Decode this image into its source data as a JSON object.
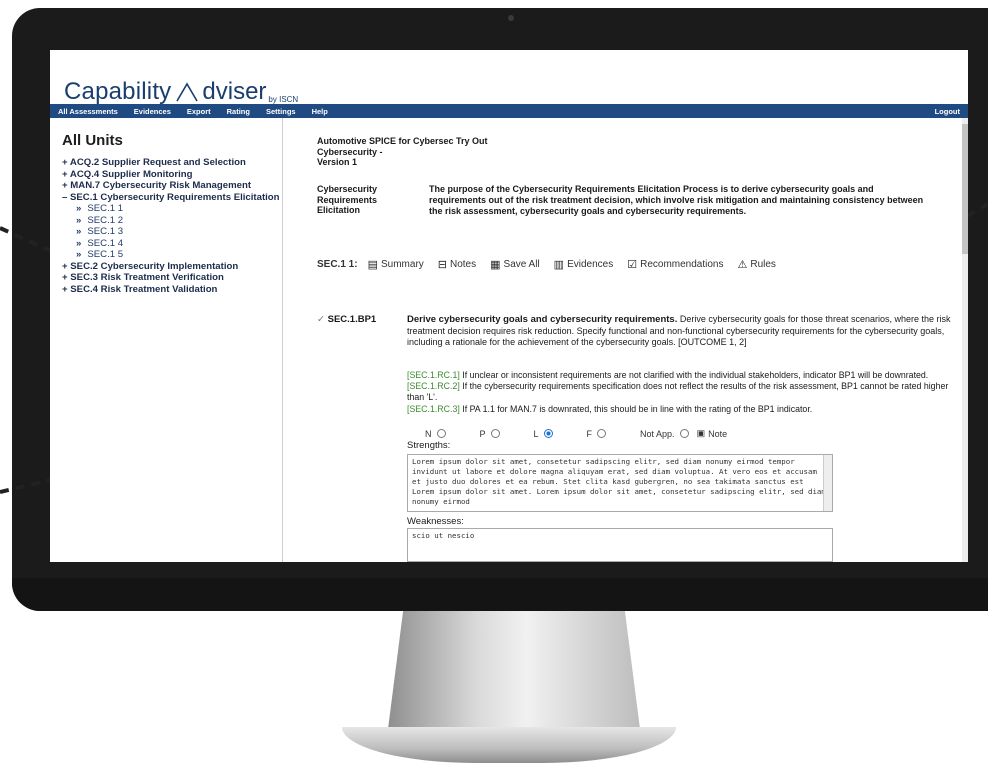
{
  "app": {
    "logo_word1": "Capability",
    "logo_word2": "dviser",
    "logo_by": "by ISCN"
  },
  "menu": {
    "items": [
      "All Assessments",
      "Evidences",
      "Export",
      "Rating",
      "Settings",
      "Help"
    ],
    "logout": "Logout"
  },
  "sidebar": {
    "title": "All Units",
    "tree": [
      {
        "label": "+ ACQ.2 Supplier Request and Selection",
        "level": 0
      },
      {
        "label": "+ ACQ.4 Supplier Monitoring",
        "level": 0
      },
      {
        "label": "+ MAN.7 Cybersecurity Risk Management",
        "level": 0
      },
      {
        "label": "– SEC.1 Cybersecurity Requirements Elicitation",
        "level": 0
      },
      {
        "label": "SEC.1 1",
        "level": 1
      },
      {
        "label": "SEC.1 2",
        "level": 1
      },
      {
        "label": "SEC.1 3",
        "level": 1
      },
      {
        "label": "SEC.1 4",
        "level": 1
      },
      {
        "label": "SEC.1 5",
        "level": 1
      },
      {
        "label": "+ SEC.2 Cybersecurity Implementation",
        "level": 0
      },
      {
        "label": "+ SEC.3 Risk Treatment Verification",
        "level": 0
      },
      {
        "label": "+ SEC.4 Risk Treatment Validation",
        "level": 0
      }
    ],
    "sub_marker": "»"
  },
  "header": {
    "line1": "Automotive SPICE for Cybersec Try Out",
    "line2": "Cybersecurity -",
    "line3": "Version 1"
  },
  "process": {
    "name": "Cybersecurity Requirements Elicitation",
    "purpose": "The purpose of the Cybersecurity Requirements Elicitation Process is to derive cybersecurity goals and requirements out of the risk treatment decision, which involve risk mitigation and maintaining consistency between the risk assessment, cybersecurity goals and cybersecurity requirements."
  },
  "toolbar": {
    "section_label": "SEC.1 1:",
    "buttons": [
      {
        "label": "Summary",
        "icon": "summary-icon",
        "glyph": "▤"
      },
      {
        "label": "Notes",
        "icon": "notes-icon",
        "glyph": "⊟"
      },
      {
        "label": "Save All",
        "icon": "save-icon",
        "glyph": "▦"
      },
      {
        "label": "Evidences",
        "icon": "evidences-icon",
        "glyph": "▥"
      },
      {
        "label": "Recommendations",
        "icon": "recommendations-icon",
        "glyph": "☑"
      },
      {
        "label": "Rules",
        "icon": "rules-icon",
        "glyph": "⚠"
      }
    ]
  },
  "bp": {
    "id": "SEC.1.BP1",
    "check": "✓",
    "title": "Derive cybersecurity goals and cybersecurity requirements.",
    "text": "Derive cybersecurity goals for those threat scenarios, where the risk treatment decision requires risk reduction. Specify functional and non-functional cybersecurity requirements for the cybersecurity goals, including a rationale for the achievement of the cybersecurity goals. [OUTCOME 1, 2]",
    "rules": [
      {
        "code": "[SEC.1.RC.1]",
        "text": " If unclear or inconsistent requirements are not clarified with the individual stakeholders, indicator BP1 will be downrated."
      },
      {
        "code": "[SEC.1.RC.2]",
        "text": " If the cybersecurity requirements specification does not reflect the results of the risk assessment, BP1 cannot be rated higher than 'L'."
      },
      {
        "code": "[SEC.1.RC.3]",
        "text": " If PA 1.1 for MAN.7 is downrated, this should be in line with the rating of the BP1 indicator."
      }
    ],
    "rating": {
      "options": [
        "N",
        "P",
        "L",
        "F",
        "Not App."
      ],
      "selected": "L",
      "note_label": "Note"
    },
    "strengths_label": "Strengths:",
    "strengths": "Lorem ipsum dolor sit amet, consetetur sadipscing elitr, sed diam nonumy eirmod tempor invidunt ut labore et dolore magna aliquyam erat, sed diam voluptua. At vero eos et accusam et justo duo dolores et ea rebum. Stet clita kasd gubergren, no sea takimata sanctus est Lorem ipsum dolor sit amet. Lorem ipsum dolor sit amet, consetetur sadipscing elitr, sed diam nonumy eirmod",
    "weaknesses_label": "Weaknesses:",
    "weaknesses": "scio ut nescio"
  }
}
